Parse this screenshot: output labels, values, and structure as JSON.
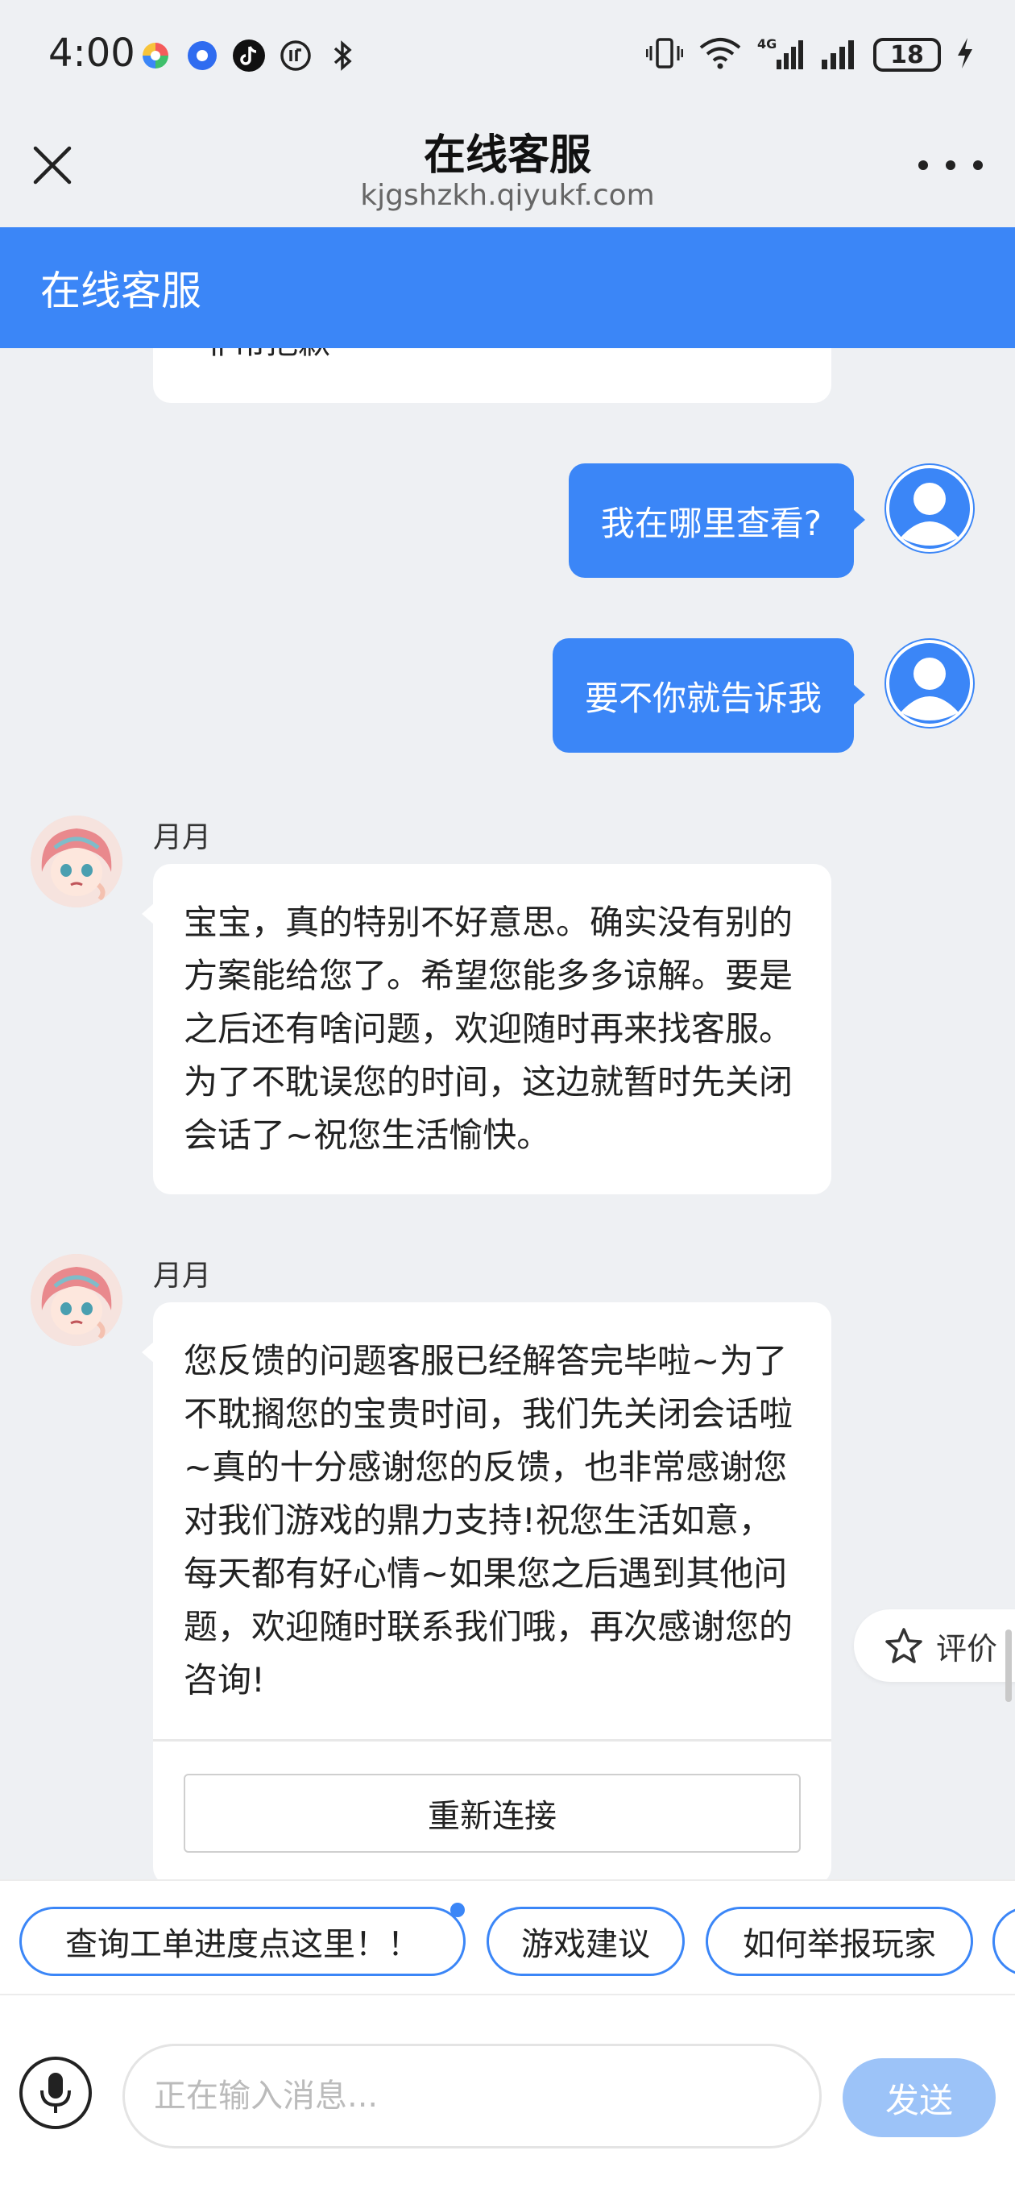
{
  "status_bar": {
    "time": "4:00",
    "network": "4G",
    "battery": "18"
  },
  "header": {
    "title": "在线客服",
    "url": "kjgshzkh.qiyukf.com"
  },
  "banner": {
    "title": "在线客服"
  },
  "chat": {
    "partial_message": "非常抱歉",
    "user_messages": [
      {
        "text": "我在哪里查看?"
      },
      {
        "text": "要不你就告诉我"
      }
    ],
    "agent_messages": [
      {
        "name": "月月",
        "text": "宝宝，真的特别不好意思。确实没有别的方案能给您了。希望您能多多谅解。要是之后还有啥问题，欢迎随时再来找客服。为了不耽误您的时间，这边就暂时先关闭会话了~祝您生活愉快。"
      },
      {
        "name": "月月",
        "text": "您反馈的问题客服已经解答完毕啦~为了不耽搁您的宝贵时间，我们先关闭会话啦~真的十分感谢您的反馈，也非常感谢您对我们游戏的鼎力支持!祝您生活如意，每天都有好心情~如果您之后遇到其他问题，欢迎随时联系我们哦，再次感谢您的咨询!",
        "reconnect_label": "重新连接"
      }
    ],
    "rate_label": "评价"
  },
  "quick_replies": [
    {
      "label": "查询工单进度点这里！！"
    },
    {
      "label": "游戏建议"
    },
    {
      "label": "如何举报玩家"
    }
  ],
  "input": {
    "placeholder": "正在输入消息...",
    "send_label": "发送"
  },
  "colors": {
    "accent": "#3b86f7",
    "send_disabled": "#9cc3f8",
    "background": "#eef0f3"
  }
}
